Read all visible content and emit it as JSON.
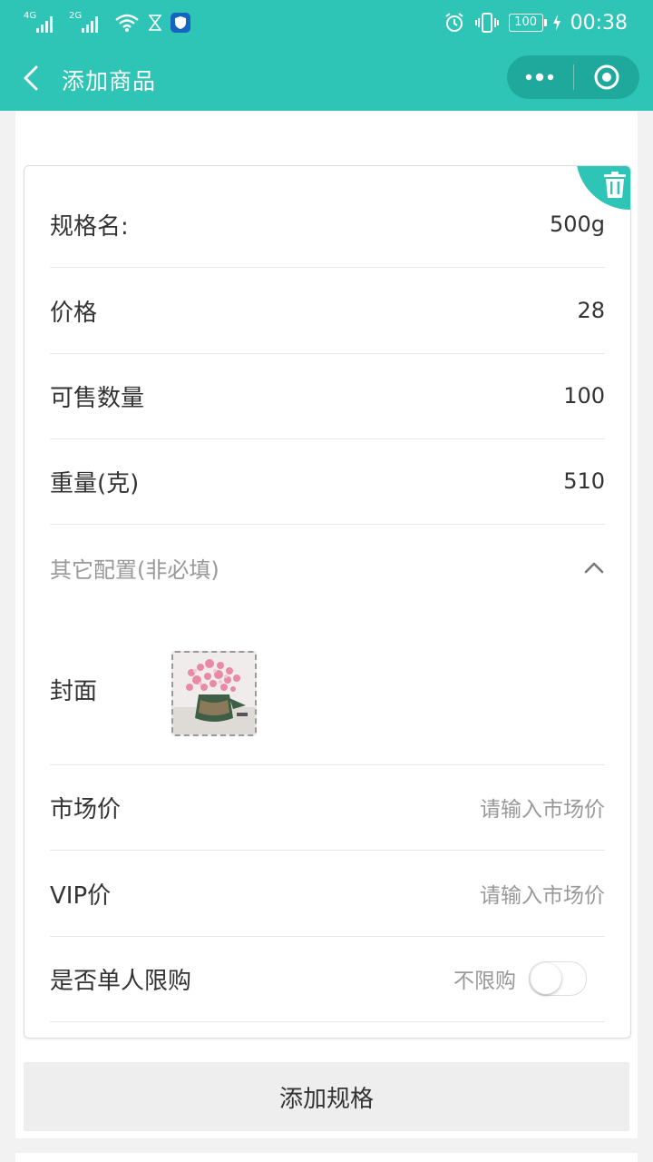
{
  "status_bar": {
    "net1": "4G",
    "net2": "2G",
    "battery": "100",
    "time": "00:38"
  },
  "nav": {
    "title": "添加商品"
  },
  "spec": {
    "name_label": "规格名:",
    "name_value": "500g",
    "price_label": "价格",
    "price_value": "28",
    "stock_label": "可售数量",
    "stock_value": "100",
    "weight_label": "重量(克)",
    "weight_value": "510",
    "other_config_label": "其它配置(非必填)",
    "cover_label": "封面",
    "market_price_label": "市场价",
    "market_price_placeholder": "请输入市场价",
    "vip_price_label": "VIP价",
    "vip_price_placeholder": "请输入市场价",
    "limit_label": "是否单人限购",
    "limit_status": "不限购"
  },
  "add_spec_button": "添加规格",
  "colors": {
    "accent": "#2ec4b6",
    "accent_dark": "#1ea99c"
  }
}
